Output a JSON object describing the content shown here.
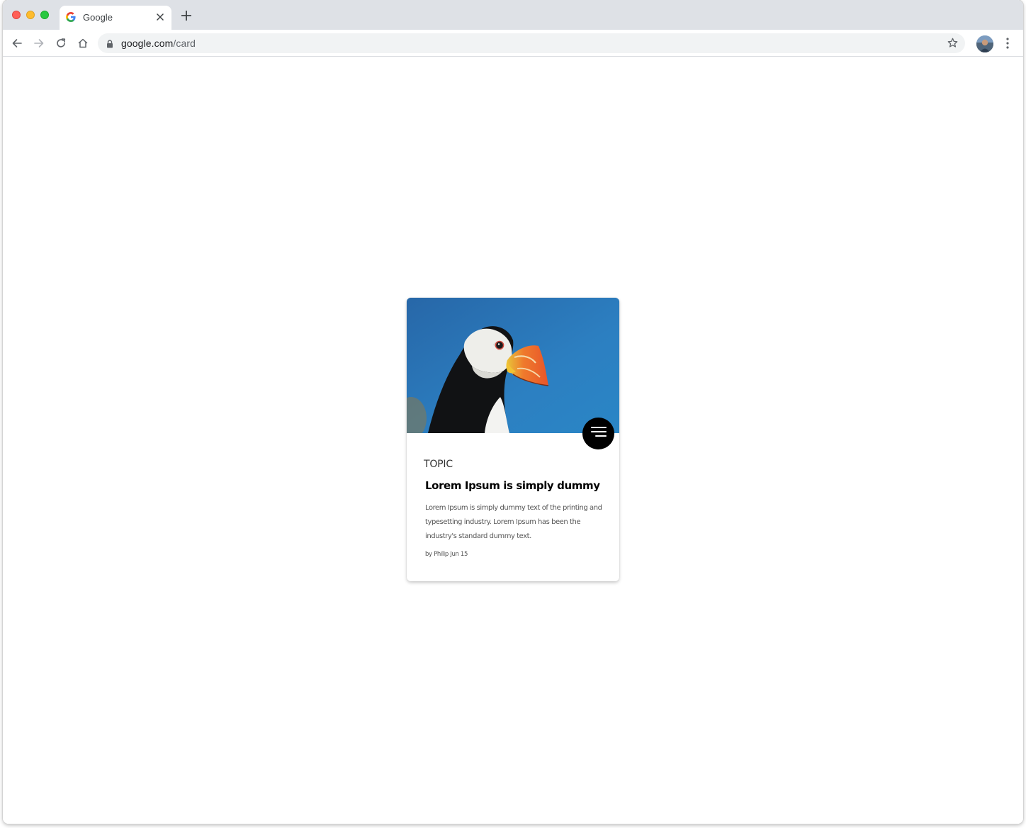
{
  "browser": {
    "tab_title": "Google",
    "url_host": "google.com",
    "url_path": "/card"
  },
  "card": {
    "image_subject": "puffin",
    "fab_icon": "menu-lines-icon",
    "topic": "TOPIC",
    "title": "Lorem Ipsum is simply dummy",
    "body": "Lorem Ipsum is simply dummy text of the printing and typesetting industry. Lorem Ipsum has been the industry's standard dummy text.",
    "meta": "by Philip Jun 15"
  },
  "colors": {
    "fab": "#000000",
    "image_sky": "#2c7ec0"
  }
}
